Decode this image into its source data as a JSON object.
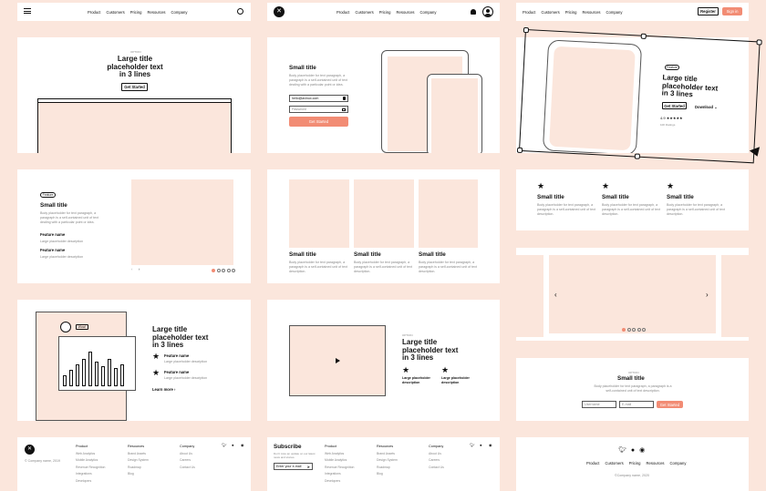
{
  "nav": [
    "Product",
    "Customers",
    "Pricing",
    "Resources",
    "Company"
  ],
  "auth": {
    "register": "Register",
    "signin": "Sign in"
  },
  "eyebrow": "OPTION",
  "large_title": "Large title placeholder text in 3 lines",
  "large_title_lines": [
    "Large title",
    "placeholder text",
    "in 3 lines"
  ],
  "get_started": "Get Started",
  "small_title": "Small title",
  "body_text": "Body placeholder for text paragraph, a paragraph is a self-contained unit of text dealing with a particular point or idea.",
  "body_short": "Body placeholder for text paragraph, a paragraph is a self-contained unit of text description.",
  "email_value": "hello@avinux.com",
  "password_placeholder": "Password",
  "feature_pill": "Feature",
  "download": "Download",
  "rating": "4.9",
  "review_count": "10K Ratings",
  "feature_name": "Feature name",
  "feature_desc": "Large placeholder description",
  "learn_more": "Learn more",
  "wow_label": "Wow!",
  "large_desc": "Large placeholder description",
  "form": {
    "username": "Username",
    "email": "E-mail"
  },
  "footer": {
    "copyright": "© Company name, 2019",
    "copyright2": "©Company name, 2020",
    "product": {
      "title": "Product",
      "items": [
        "Web Analytics",
        "Mobile Analytics",
        "Revenue Recognition",
        "Integrations",
        "Developers"
      ]
    },
    "resources": {
      "title": "Resources",
      "items": [
        "Brand Assets",
        "Design System",
        "Roadmap",
        "Blog"
      ]
    },
    "company": {
      "title": "Company",
      "items": [
        "About Us",
        "Careers",
        "Contact Us"
      ]
    },
    "subscribe": "Subscribe",
    "subscribe_text": "Don't miss an update on our latest news and stories.",
    "email_placeholder": "Enter your e-mail"
  }
}
